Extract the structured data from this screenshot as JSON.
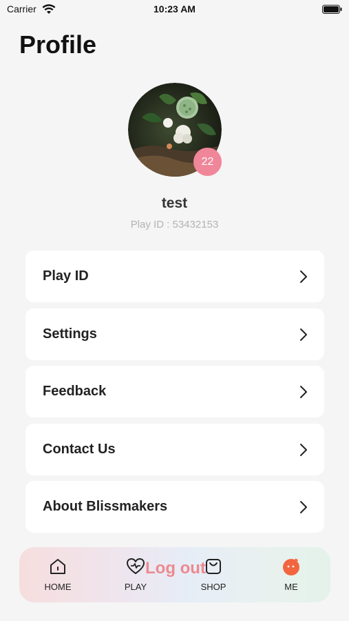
{
  "status_bar": {
    "carrier": "Carrier",
    "time": "10:23 AM"
  },
  "page": {
    "title": "Profile"
  },
  "profile": {
    "level": "22",
    "username": "test",
    "play_id": "Play ID : 53432153"
  },
  "menu": {
    "items": [
      {
        "label": "Play ID"
      },
      {
        "label": "Settings"
      },
      {
        "label": "Feedback"
      },
      {
        "label": "Contact Us"
      },
      {
        "label": "About Blissmakers"
      }
    ]
  },
  "logout_label": "Log out",
  "tab_bar": {
    "tabs": [
      {
        "label": "HOME",
        "icon": "home-icon"
      },
      {
        "label": "PLAY",
        "icon": "heart-pulse-icon"
      },
      {
        "label": "SHOP",
        "icon": "shopping-bag-icon"
      },
      {
        "label": "ME",
        "icon": "me-avatar-icon"
      }
    ],
    "active_color": "#f2663f"
  }
}
